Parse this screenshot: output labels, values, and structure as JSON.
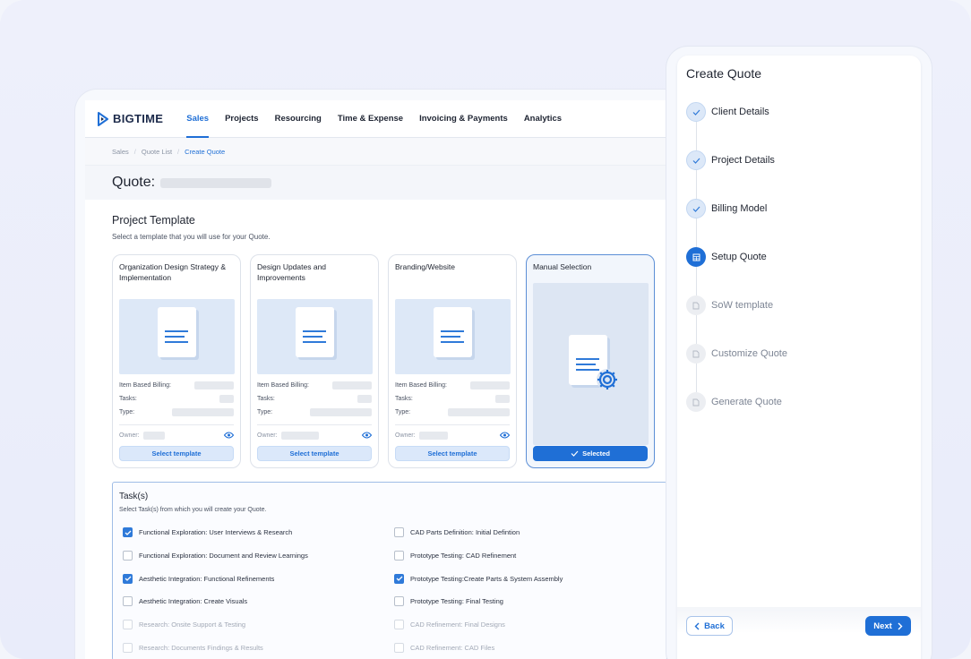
{
  "app": {
    "logo": "BIGTIME",
    "nav": [
      "Sales",
      "Projects",
      "Resourcing",
      "Time & Expense",
      "Invoicing & Payments",
      "Analytics"
    ],
    "active_nav": "Sales"
  },
  "breadcrumb": [
    "Sales",
    "Quote List",
    "Create Quote"
  ],
  "quote": {
    "label": "Quote:"
  },
  "project_template": {
    "title": "Project Template",
    "subtitle": "Select a template that you will use for your Quote.",
    "meta_labels": {
      "billing": "Item Based Billing:",
      "tasks": "Tasks:",
      "type": "Type:",
      "owner": "Owner:"
    },
    "cards": [
      {
        "title": "Organization Design Strategy & Implementation",
        "button": "Select template"
      },
      {
        "title": "Design Updates and Improvements",
        "button": "Select template"
      },
      {
        "title": "Branding/Website",
        "button": "Select template"
      },
      {
        "title": "Manual Selection",
        "button": "Selected"
      }
    ]
  },
  "tasks": {
    "title": "Task(s)",
    "subtitle": "Select Task(s) from which you will create your Quote.",
    "items": [
      {
        "label": "Functional Exploration: User Interviews & Research",
        "checked": true
      },
      {
        "label": "CAD Parts Definition: Initial Defintion",
        "checked": false
      },
      {
        "label": "Functional Exploration: Document and Review Learnings",
        "checked": false
      },
      {
        "label": "Prototype Testing: CAD Refinement",
        "checked": false
      },
      {
        "label": "Aesthetic Integration: Functional Refinements",
        "checked": true
      },
      {
        "label": "Prototype Testing:Create Parts & System Assembly",
        "checked": true
      },
      {
        "label": "Aesthetic Integration: Create Visuals",
        "checked": false
      },
      {
        "label": "Prototype Testing: Final Testing",
        "checked": false
      },
      {
        "label": "Research: Onsite Support & Testing",
        "checked": false
      },
      {
        "label": "CAD Refinement: Final Designs",
        "checked": false
      },
      {
        "label": "Research: Documents Findings & Results",
        "checked": false
      },
      {
        "label": "CAD Refinement: CAD Files",
        "checked": false
      }
    ]
  },
  "wizard": {
    "title": "Create Quote",
    "steps": [
      {
        "label": "Client Details",
        "state": "done"
      },
      {
        "label": "Project Details",
        "state": "done"
      },
      {
        "label": "Billing Model",
        "state": "done"
      },
      {
        "label": "Setup Quote",
        "state": "current"
      },
      {
        "label": "SoW template",
        "state": "pending"
      },
      {
        "label": "Customize Quote",
        "state": "pending"
      },
      {
        "label": "Generate Quote",
        "state": "pending"
      }
    ],
    "back_label": "Back",
    "next_label": "Next"
  },
  "colors": {
    "accent": "#1f6fd6",
    "check": "#2f7ad9",
    "selected_border": "#5c8fd6"
  }
}
